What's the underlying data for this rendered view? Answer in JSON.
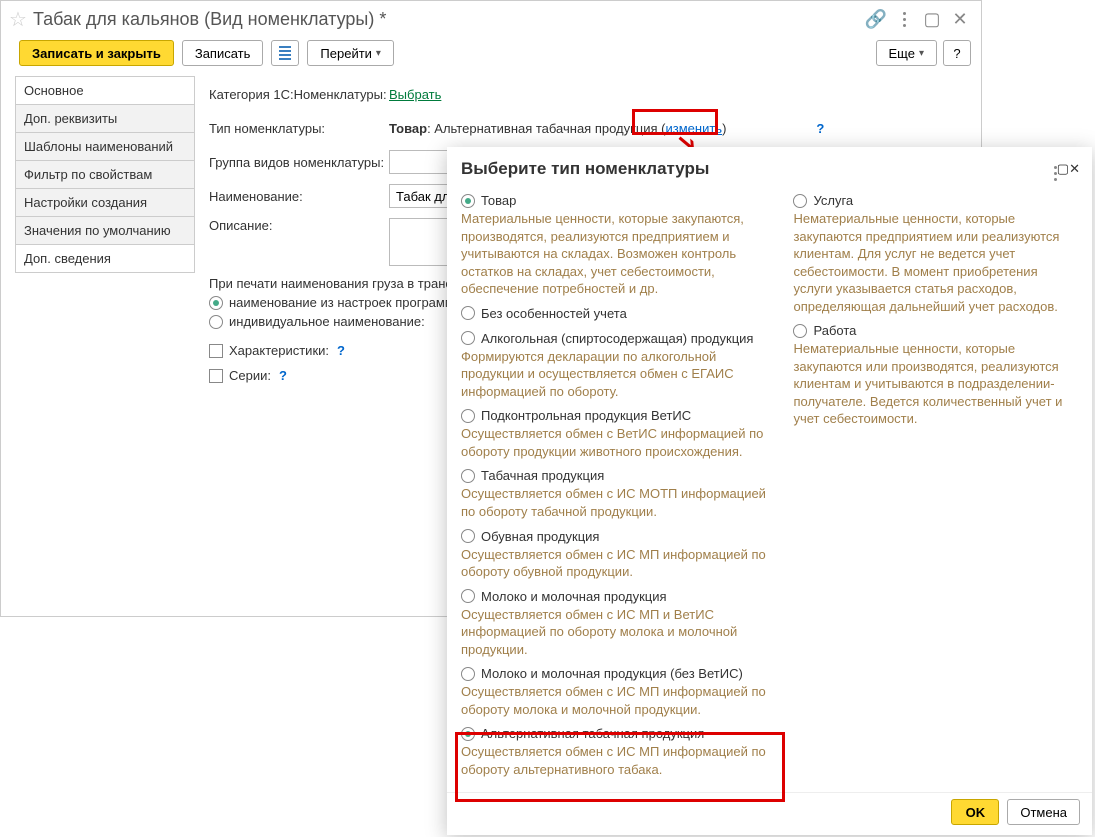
{
  "main": {
    "title": "Табак для кальянов (Вид номенклатуры) *",
    "toolbar": {
      "save_close": "Записать и закрыть",
      "save": "Записать",
      "goto": "Перейти",
      "more": "Еще",
      "help": "?"
    },
    "nav": [
      "Основное",
      "Доп. реквизиты",
      "Шаблоны наименований",
      "Фильтр по свойствам",
      "Настройки создания",
      "Значения по умолчанию",
      "Доп. сведения"
    ],
    "form": {
      "cat_label": "Категория 1С:Номенклатуры:",
      "cat_link": "Выбрать",
      "type_label": "Тип номенклатуры:",
      "type_value_prefix": "Товар",
      "type_value_suffix": ": Альтернативная табачная продукция (",
      "type_change": "изменить",
      "type_close": ")",
      "group_label": "Группа видов номенклатуры:",
      "name_label": "Наименование:",
      "name_value": "Табак для к",
      "desc_label": "Описание:",
      "print_intro": "При печати наименования груза в транспо",
      "radio1": "наименование из настроек программы",
      "radio2": "индивидуальное наименование:",
      "chk1": "Характеристики:",
      "chk2": "Серии:"
    }
  },
  "popup": {
    "title": "Выберите тип номенклатуры",
    "col1": {
      "goods": "Товар",
      "goods_desc": "Материальные ценности, которые закупаются, производятся, реализуются предприятием и учитываются на складах. Возможен контроль остатков на складах, учет себестоимости, обеспечение потребностей и др.",
      "sub": [
        {
          "label": "Без особенностей учета",
          "desc": ""
        },
        {
          "label": "Алкогольная (спиртосодержащая) продукция",
          "desc": "Формируются декларации по алкогольной продукции и осуществляется обмен с ЕГАИС информацией по обороту."
        },
        {
          "label": "Подконтрольная продукция ВетИС",
          "desc": "Осуществляется обмен с ВетИС информацией по обороту продукции животного происхождения."
        },
        {
          "label": "Табачная продукция",
          "desc": "Осуществляется обмен с ИС МОТП информацией по обороту табачной продукции."
        },
        {
          "label": "Обувная продукция",
          "desc": "Осуществляется обмен с ИС МП информацией по обороту обувной продукции."
        },
        {
          "label": "Молоко и молочная продукция",
          "desc": "Осуществляется обмен с ИС МП и ВетИС информацией по обороту молока и молочной продукции."
        },
        {
          "label": "Молоко и молочная продукция (без ВетИС)",
          "desc": "Осуществляется обмен с ИС МП информацией по обороту молока и молочной продукции."
        },
        {
          "label": "Альтернативная табачная продукция",
          "desc": "Осуществляется обмен с ИС МП информацией по обороту альтернативного табака."
        }
      ]
    },
    "col2": {
      "service": "Услуга",
      "service_desc": "Нематериальные ценности, которые закупаются предприятием или реализуются клиентам. Для услуг не ведется учет себестоимости. В момент приобретения услуги указывается статья расходов, определяющая дальнейший учет расходов.",
      "work": "Работа",
      "work_desc": "Нематериальные ценности, которые закупаются или производятся, реализуются клиентам и учитываются в подразделении-получателе. Ведется количественный учет и учет себестоимости."
    },
    "footer": {
      "ok": "OK",
      "cancel": "Отмена"
    }
  }
}
